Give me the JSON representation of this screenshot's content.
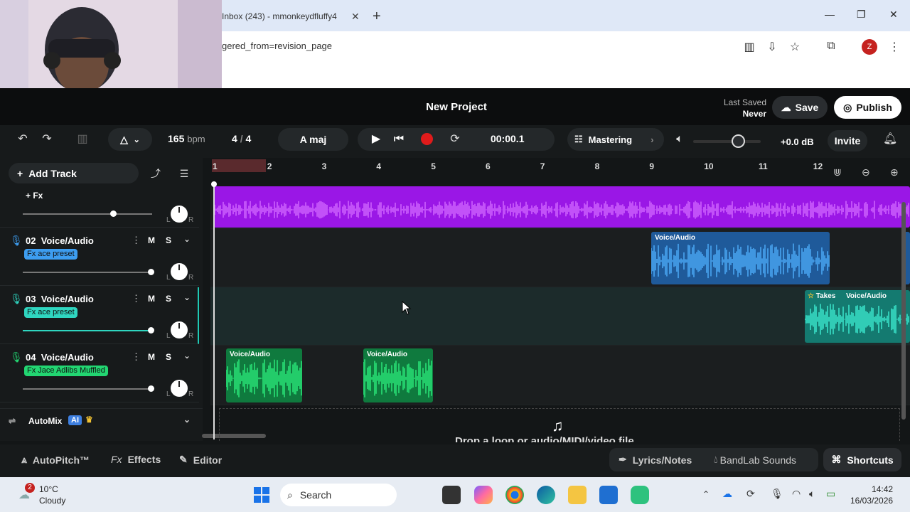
{
  "browser": {
    "tab_title": "Inbox (243) - mmonkeydfluffy4",
    "url": "gered_from=revision_page",
    "profile_initial": "Z"
  },
  "header": {
    "project_title": "New Project",
    "last_saved_label": "Last Saved",
    "last_saved_value": "Never",
    "save_label": "Save",
    "publish_label": "Publish"
  },
  "transport": {
    "bpm_value": "165",
    "bpm_unit": "bpm",
    "time_sig_num": "4",
    "time_sig_sep": "/",
    "time_sig_den": "4",
    "key": "A maj",
    "time": "00:00.1",
    "mastering_label": "Mastering",
    "master_volume_level": 0.58,
    "db_label": "+0.0 dB",
    "invite_label": "Invite"
  },
  "left_panel": {
    "add_track_label": "Add Track",
    "top_fx_label": "+ Fx",
    "tracks": [
      {
        "number": "02",
        "name": "Voice/Audio",
        "fx": "Fx ace preset",
        "fx_color": "#3d9df0",
        "mic_color": "#3d9df0",
        "mute": "M",
        "solo": "S"
      },
      {
        "number": "03",
        "name": "Voice/Audio",
        "fx": "Fx ace preset",
        "fx_color": "#2fd6c0",
        "mic_color": "#2fd6c0",
        "mute": "M",
        "solo": "S"
      },
      {
        "number": "04",
        "name": "Voice/Audio",
        "fx": "Fx Jace Adlibs Muffled",
        "fx_color": "#22d672",
        "mic_color": "#22d672",
        "mute": "M",
        "solo": "S"
      }
    ],
    "lr_left": "L",
    "lr_right": "R",
    "automix_label": "AutoMix",
    "automix_badge": "AI"
  },
  "ruler": {
    "bars": [
      "1",
      "2",
      "3",
      "4",
      "5",
      "6",
      "7",
      "8",
      "9",
      "10",
      "11",
      "12"
    ]
  },
  "clips": {
    "label": "Voice/Audio",
    "takes_label": "Takes",
    "colors": {
      "purple": "#a020f0",
      "blue": "#2f8fe8",
      "teal": "#1fc9b4",
      "green": "#1fd66a"
    }
  },
  "drop_zone_text": "Drop a loop or audio/MIDI/video file",
  "bottom_bar": {
    "autopitch": "AutoPitch™",
    "effects": "Effects",
    "editor": "Editor",
    "lyrics": "Lyrics/Notes",
    "sounds": "BandLab Sounds",
    "shortcuts": "Shortcuts"
  },
  "taskbar": {
    "weather_temp": "10°C",
    "weather_desc": "Cloudy",
    "weather_badge": "2",
    "search_placeholder": "Search",
    "time": "14:42",
    "date": "16/03/2026"
  }
}
